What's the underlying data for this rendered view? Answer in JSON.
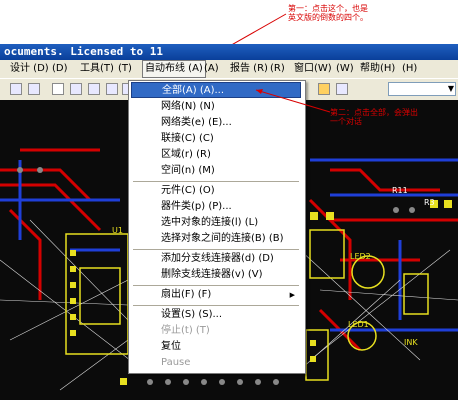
{
  "annotations": {
    "first": "第一：点击这个，也是\n英文版的倒数的四个。",
    "second": "第二：点击全部，会弹出\n一个对话"
  },
  "window": {
    "title": "ocuments. Licensed to 11"
  },
  "menubar": {
    "items": [
      {
        "label": "设计 (D)"
      },
      {
        "label": "(D)"
      },
      {
        "label": "工具(T)"
      },
      {
        "label": "(T)"
      },
      {
        "label": "自动布线 (A)"
      },
      {
        "label": "(A)"
      },
      {
        "label": "报告 (R)"
      },
      {
        "label": "(R)"
      },
      {
        "label": "窗口(W)"
      },
      {
        "label": "(W)"
      },
      {
        "label": "帮助(H)"
      },
      {
        "label": "(H)"
      }
    ]
  },
  "toolbar": {
    "combo_arrow": "▼",
    "icons": [
      "print-icon",
      "print-preview-icon",
      "page-icon",
      "zoom-in-icon",
      "zoom-out-icon",
      "zoom-fit-icon",
      "select-icon",
      "pencil-icon",
      "highlight-icon"
    ]
  },
  "dropdown": {
    "items": [
      {
        "label": "全部(A)   (A)...",
        "highlighted": true
      },
      {
        "label": "网络(N)   (N)"
      },
      {
        "label": "网络类(e)  (E)..."
      },
      {
        "label": "联接(C)   (C)"
      },
      {
        "label": "区域(r)   (R)"
      },
      {
        "label": "空间(n)   (M)"
      },
      {
        "label": "元件(C)   (O)"
      },
      {
        "label": "器件类(p)  (P)..."
      },
      {
        "label": "选中对象的连接(l)  (L)"
      },
      {
        "label": "选择对象之间的连接(B)  (B)"
      },
      {
        "label": "添加分支线连接器(d)  (D)"
      },
      {
        "label": "删除支线连接器(v)  (V)"
      },
      {
        "label": "扇出(F)   (F)",
        "submenu": true
      },
      {
        "label": "设置(S)   (S)..."
      },
      {
        "label": "停止(t)   (T)",
        "disabled": true
      },
      {
        "label": "复位"
      },
      {
        "label": "Pause",
        "disabled": true
      }
    ],
    "submenu_arrow": "▶"
  },
  "pcb_labels": {
    "r11": "R11",
    "r3": "R3",
    "led2": "LED2",
    "led1": "LED1",
    "u1": "U1",
    "nk": "INK"
  },
  "colors": {
    "annotation": "#d80000",
    "highlight": "#316ac5",
    "trace_red": "#d40000",
    "trace_blue": "#1f3fd8",
    "pad_yellow": "#e8e020"
  }
}
